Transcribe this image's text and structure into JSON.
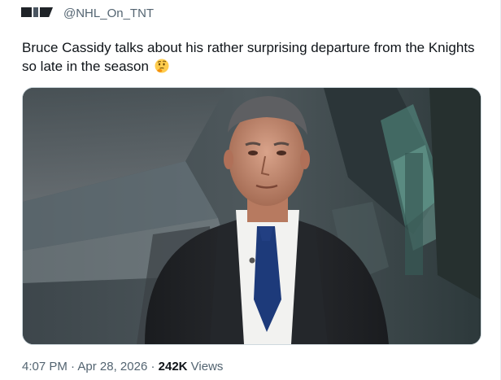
{
  "tweet": {
    "handle": "@NHL_On_TNT",
    "text": "Bruce Cassidy talks about his rather surprising departure from the Knights so late in the season",
    "emoji": "thinking-face-icon"
  },
  "meta": {
    "time": "4:07 PM",
    "separator": "·",
    "date": "Apr 28, 2026",
    "views_count": "242K",
    "views_label": "Views"
  },
  "colors": {
    "text_primary": "#0f1419",
    "text_secondary": "#536471",
    "media_border": "#cfd9de"
  }
}
